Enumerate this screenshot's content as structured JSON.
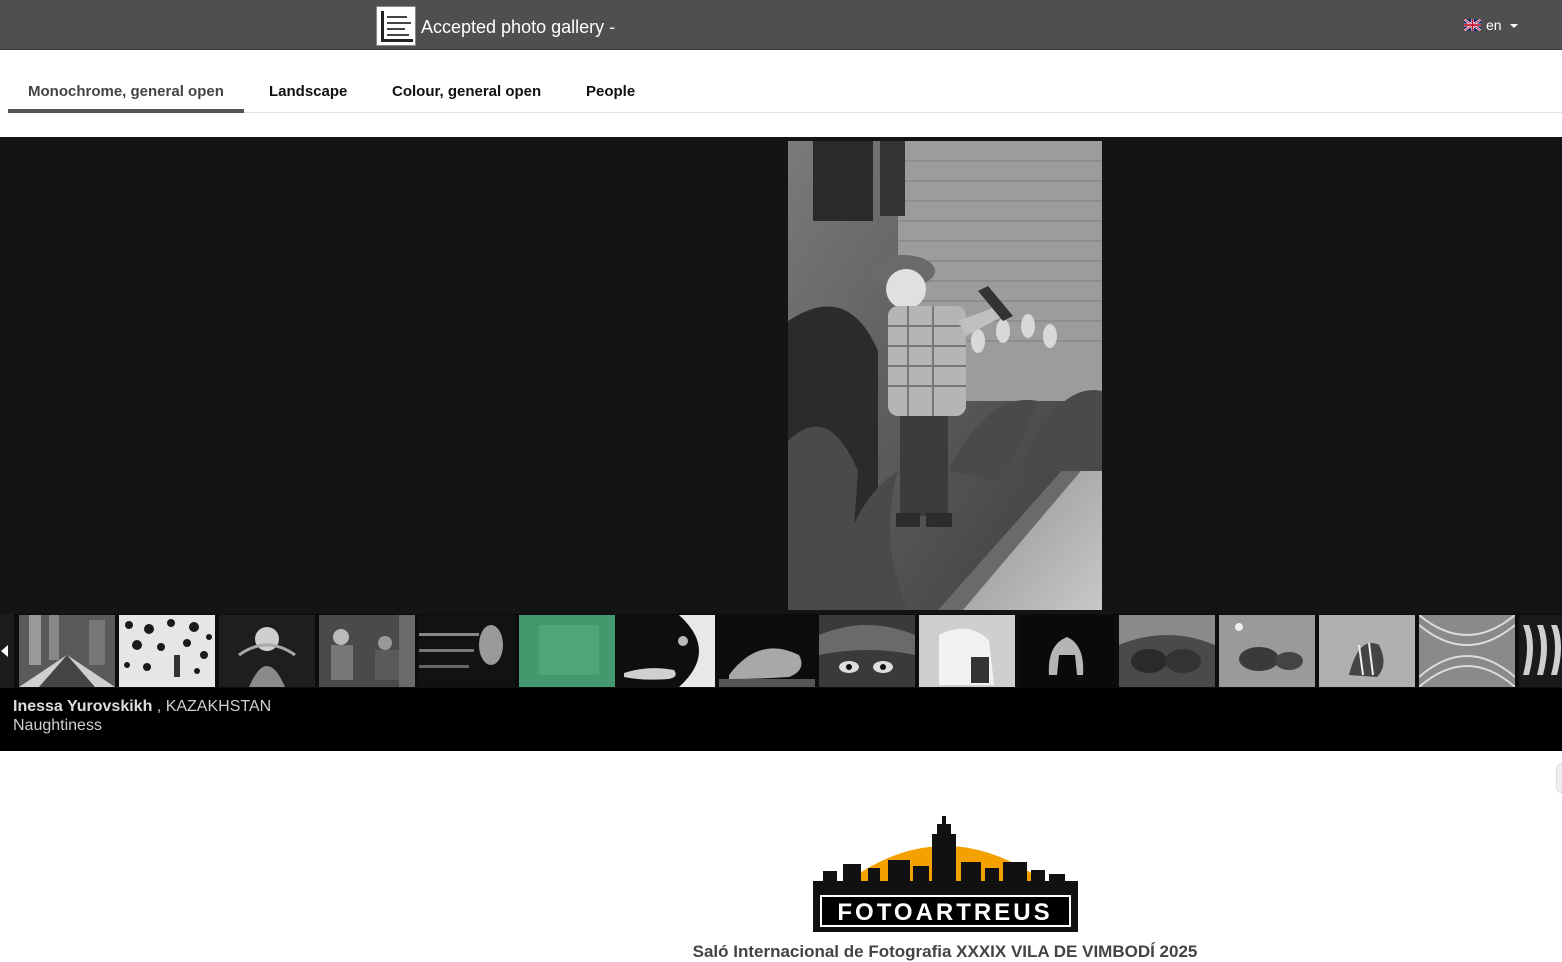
{
  "header": {
    "title": "Accepted photo gallery -",
    "logo_icon": "photo-club-logo-icon",
    "language": "en",
    "flag_icon": "uk-flag-icon"
  },
  "tabs": [
    {
      "label": "Monochrome, general open",
      "active": true
    },
    {
      "label": "Landscape",
      "active": false
    },
    {
      "label": "Colour, general open",
      "active": false
    },
    {
      "label": "People",
      "active": false
    }
  ],
  "viewer": {
    "photo_icon": "boy-with-slingshot-photo",
    "thumbnail_count": 16
  },
  "caption": {
    "author": "Inessa Yurovskikh",
    "country": ", KAZAKHSTAN",
    "title": "Naughtiness"
  },
  "footer": {
    "logo_text": "FOTOARTREUS",
    "salon_title": "Saló Internacional de Fotografia XXXIX VILA DE VIMBODÍ 2025"
  },
  "colors": {
    "topbar": "#4f4f4f",
    "viewer_bg": "#141414",
    "logo_sun": "#f4a100"
  }
}
